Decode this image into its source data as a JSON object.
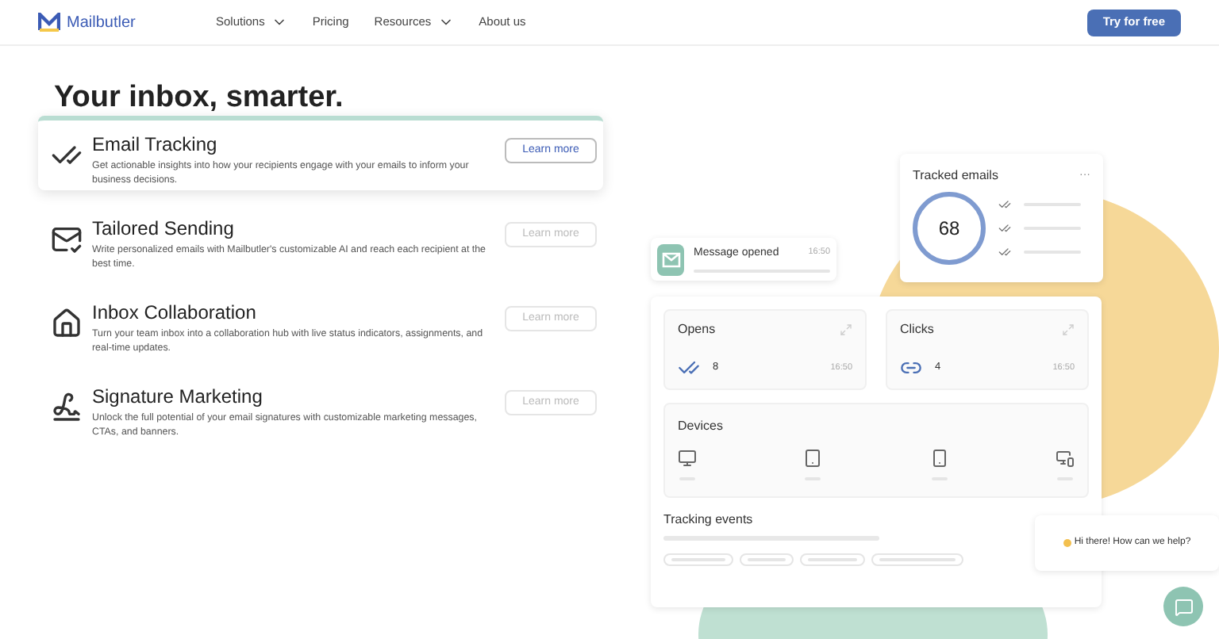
{
  "nav": {
    "logo": "Mailbutler",
    "items": [
      {
        "label": "Solutions",
        "dropdown": true
      },
      {
        "label": "Pricing",
        "dropdown": false
      },
      {
        "label": "Resources",
        "dropdown": true
      },
      {
        "label": "About us",
        "dropdown": false
      }
    ],
    "cta": "Try for free"
  },
  "heading": "Your inbox, smarter.",
  "features": [
    {
      "kind": "tracking",
      "title": "Email Tracking",
      "description": "Get actionable insights into how your recipients engage with your emails to inform your business decisions.",
      "button": "Learn more",
      "selected": true
    },
    {
      "kind": "sending",
      "title": "Tailored Sending",
      "description": "Write personalized emails with Mailbutler's customizable AI and reach each recipient at the best time.",
      "button": "Learn more",
      "selected": false
    },
    {
      "kind": "collaboration",
      "title": "Inbox Collaboration",
      "description": "Turn your team inbox into a collaboration hub with live status indicators, assignments, and real-time updates.",
      "button": "Learn more",
      "selected": false
    },
    {
      "kind": "signature",
      "title": "Signature Marketing",
      "description": "Unlock the full potential of your email signatures with customizable marketing messages, CTAs, and banners.",
      "button": "Learn more",
      "selected": false
    }
  ],
  "preview": {
    "tracked_emails": {
      "title": "Tracked emails",
      "menu": "···",
      "count": "68"
    },
    "notification": {
      "title": "Message opened",
      "time": "16:50"
    },
    "stats": [
      {
        "kind": "opens",
        "title": "Opens",
        "value": "8",
        "time": "16:50"
      },
      {
        "kind": "clicks",
        "title": "Clicks",
        "value": "4",
        "time": "16:50"
      }
    ],
    "devices": {
      "title": "Devices"
    },
    "events": {
      "title": "Tracking events"
    }
  },
  "chat": {
    "message": "Hi there! How can we help?"
  }
}
